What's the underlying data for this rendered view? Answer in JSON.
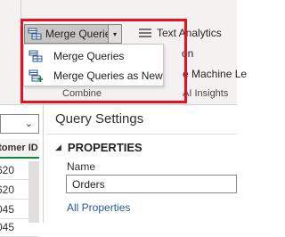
{
  "ribbon": {
    "merge_queries_label": "Merge Queries",
    "dropdown_glyph": "▾",
    "menu": [
      {
        "label": "Merge Queries",
        "icon": "merge-queries-icon"
      },
      {
        "label": "Merge Queries as New",
        "icon": "merge-queries-new-icon"
      }
    ],
    "group_label": "Combine",
    "text_analytics_label": "Text Analytics",
    "fragment_on": "on",
    "fragment_machine_learning": "e Machine Le",
    "fragment_ai_insights": "AI Insights"
  },
  "table": {
    "dropdown_glyph": "⌄",
    "column_header": "stomer ID",
    "rows": [
      "620",
      "620",
      "045",
      "045"
    ]
  },
  "query_settings": {
    "title": "Query Settings",
    "section_glyph": "◢",
    "section": "PROPERTIES",
    "name_label": "Name",
    "name_value": "Orders",
    "all_properties_link": "All Properties"
  },
  "colors": {
    "highlight": "#e81123",
    "ribbon_bg": "#f3f2f1",
    "link": "#2b579a",
    "column_accent": "#10893e"
  }
}
